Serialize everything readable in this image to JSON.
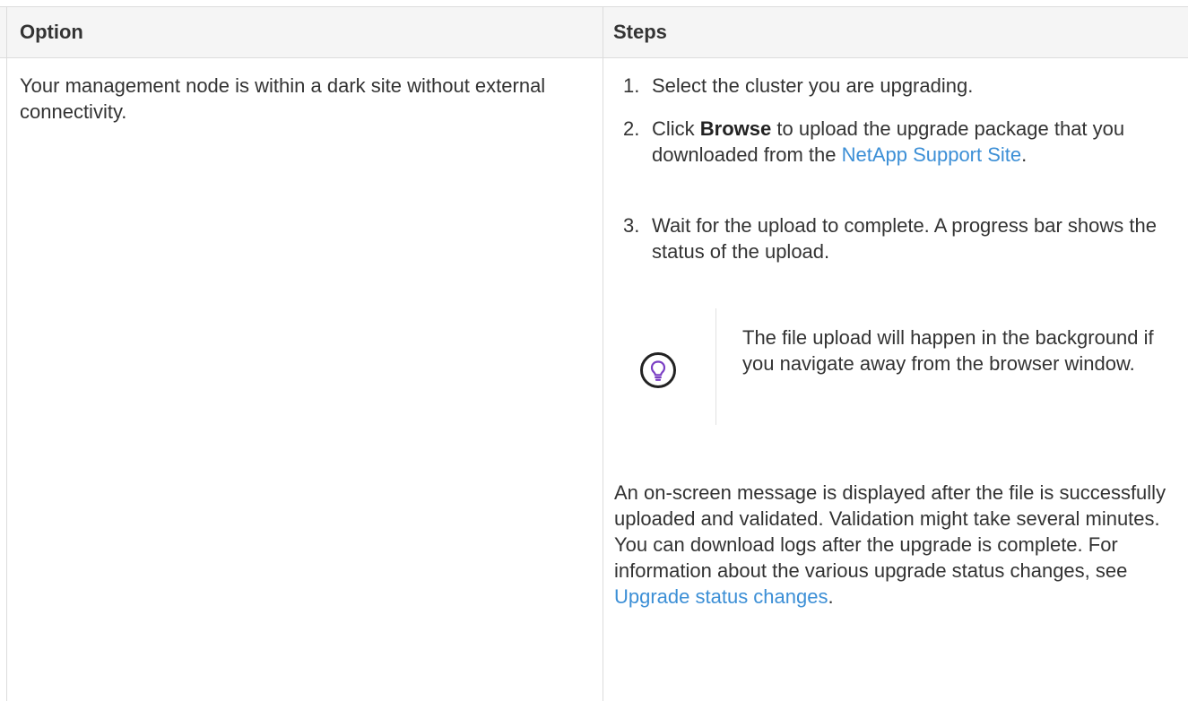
{
  "table": {
    "headers": {
      "option": "Option",
      "steps": "Steps"
    },
    "row": {
      "option_text": "Your management node is within a dark site without external connectivity.",
      "steps": [
        {
          "num": "1.",
          "text": "Select the cluster you are upgrading."
        },
        {
          "num": "2.",
          "pre": "Click ",
          "bold": "Browse",
          "post": " to upload the upgrade package that you downloaded from the ",
          "link": "NetApp Support Site",
          "end": "."
        },
        {
          "num": "3.",
          "text": "Wait for the upload to complete. A progress bar shows the status of the upload."
        }
      ],
      "tip": {
        "icon": "lightbulb-icon",
        "text": "The file upload will happen in the background if you navigate away from the browser window."
      },
      "after_p1": "An on-screen message is displayed after the file is successfully uploaded and validated. Validation might take several minutes.",
      "after_p2_pre": "You can download logs after the upgrade is complete. For information about the various upgrade status changes, see ",
      "after_p2_link": "Upgrade status changes",
      "after_p2_end": "."
    }
  },
  "colors": {
    "link": "#3c8fd6",
    "tip_icon": "#7b3fc4",
    "header_bg": "#f5f5f5"
  }
}
